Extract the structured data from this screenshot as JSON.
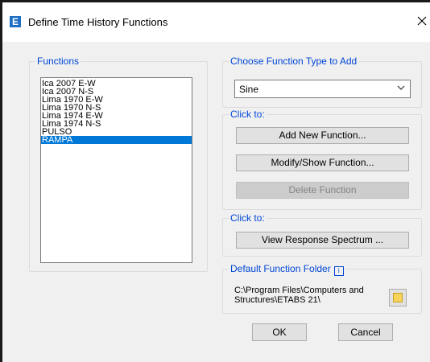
{
  "window": {
    "title": "Define Time History Functions",
    "app_icon_letter": "E",
    "close_glyph": "✕"
  },
  "functions_group": {
    "label": "Functions",
    "items": [
      "Ica 2007 E-W",
      "Ica 2007 N-S",
      "Lima 1970 E-W",
      "Lima 1970 N-S",
      "Lima 1974 E-W",
      "Lima 1974 N-S",
      "PULSO",
      "RAMPA"
    ],
    "selected": "RAMPA"
  },
  "choose_group": {
    "label": "Choose Function Type to Add",
    "selected_value": "Sine"
  },
  "click_group": {
    "label": "Click to:",
    "add_label": "Add New Function...",
    "modify_label": "Modify/Show Function...",
    "delete_label": "Delete Function"
  },
  "spectrum_group": {
    "label": "Click to:",
    "view_label": "View Response Spectrum ..."
  },
  "folder_group": {
    "label": "Default Function Folder",
    "info_glyph": "i",
    "path_line1": "C:\\Program Files\\Computers and",
    "path_line2": "Structures\\ETABS 21\\"
  },
  "footer": {
    "ok_label": "OK",
    "cancel_label": "Cancel"
  },
  "colors": {
    "group_label": "#0046d5",
    "selection": "#0078d7",
    "app_icon": "#1f6fc5"
  }
}
